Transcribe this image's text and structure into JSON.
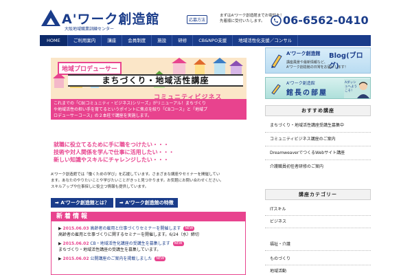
{
  "header": {
    "logo_title": "A'ワーク創造館",
    "logo_sub": "大阪地域職業訓練センター",
    "apply_label": "応募方法",
    "phone_note_1": "まずはA'ワーク創造館までお電話を！",
    "phone_note_2": "先着順に受付いたします。",
    "phone_number": "06-6562-0410"
  },
  "nav": {
    "items": [
      "HOME",
      "ご利用案内",
      "講座",
      "会員制度",
      "施設",
      "研修",
      "CB&NPO支援",
      "地域活性化支援／コンサル"
    ]
  },
  "banner": {
    "tag": "地域プロデューサー",
    "title": "まちづくり・地域活性講座",
    "strip": "コミュニティビジネス",
    "desc_1": "これまでの「CB(コミュニティ・ビジネス)シリーズ」がリニューアル！まちづくり",
    "desc_2": "や地域活性の担い手を育てるというポイントに焦点を絞り「CBコース」と「地域プ",
    "desc_3": "ロデューサーコース」の２本柱で講座を実施します。"
  },
  "bullets": [
    "就職に役立てるために手に職をつけたい・・・",
    "技術や対人関係を学んで仕事に活用したい・・・",
    "新しい知識やスキルにチャレンジしたい・・・"
  ],
  "body_text": {
    "line_1": "A'ワーク創造館では「働くための学び」を応援しています。さまざまな講座やセミナーを開催してい",
    "line_2": "ます。あなたのやりたいことや学びたいことがきっと見つかります。お気軽にお問い合わせください。",
    "line_3": "スキルアップや仕事探しに役立つ情報も提供しています。"
  },
  "buttons": {
    "about": "A'ワーク創造館とは？",
    "features": "A'ワーク創造館の特徴"
  },
  "news": {
    "header": "新着情報",
    "items": [
      {
        "date": "2015.06.03",
        "title": "高齢者の雇用と仕事づくりセミナーを開催します",
        "new": "NEW",
        "desc": "高齢者の雇用と仕事づくりに関するセミナーを開催します。6/24（水）締切"
      },
      {
        "date": "2015.06.02",
        "title": "CB・地域活性化講座の受講生を募集します",
        "new": "NEW",
        "desc": "まちづくり・地域活性講座の受講生を募集しています。"
      },
      {
        "date": "2015.06.02",
        "title": "公開講座のご案内を掲載しました",
        "new": "NEW",
        "desc": ""
      }
    ]
  },
  "sidebar": {
    "blog_title": "A'ワーク創造館",
    "blog_title_big": "Blog(ブログ)",
    "blog_desc_1": "講座風景や最新情報など、",
    "blog_desc_2": "A'ワーク創造館の日常をお届けします！",
    "chief_small": "A'ワーク創造館",
    "chief_title": "館長の部屋",
    "chief_bubble": "Aダッシュへようこそ！",
    "box1_header": "おすすめ講座",
    "box1_items": [
      "まちづくり・地域活性講座受講生募集中",
      "コミュニティビジネス講座のご案内",
      "DreamweaverでつくるWebサイト講座",
      "介護職員初任者研修のご案内"
    ],
    "box2_header": "講座カテゴリー",
    "box2_items": [
      "ITスキル",
      "ビジネス",
      "福祉・介護",
      "ものづくり",
      "地域活動"
    ]
  },
  "colors": {
    "brand_blue": "#1a3c8a",
    "accent_pink": "#e8438e"
  }
}
